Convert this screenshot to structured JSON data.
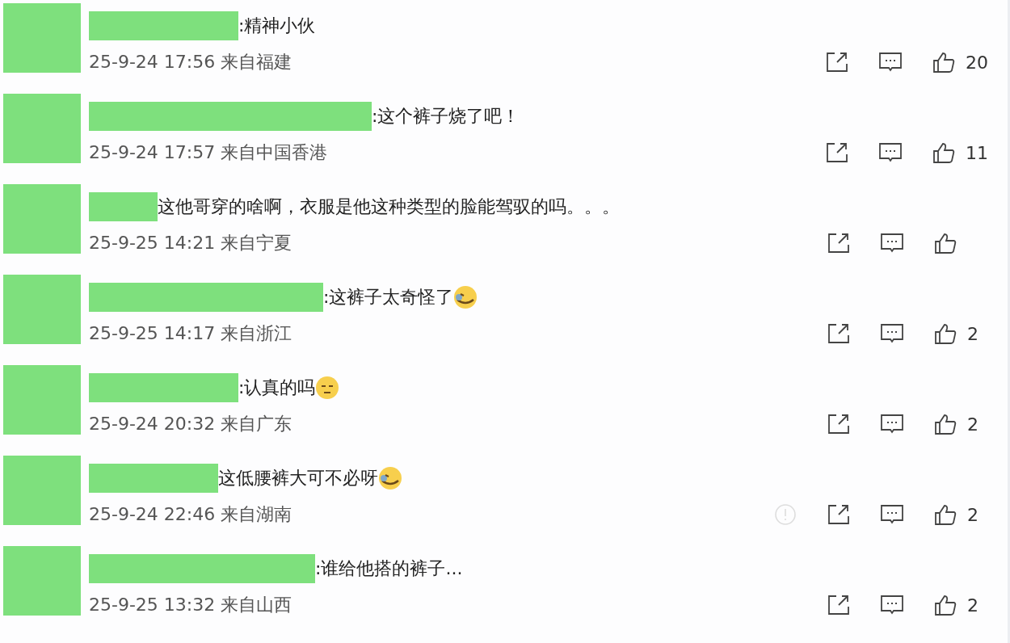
{
  "comments": [
    {
      "text": ":精神小伙",
      "kind": "plain",
      "meta": "25-9-24 17:56 来自福建",
      "report": false,
      "likes": "20"
    },
    {
      "text": ":这个裤子烧了吧！",
      "kind": "plain",
      "meta": "25-9-24 17:57 来自中国香港",
      "report": false,
      "likes": "11"
    },
    {
      "text": "这他哥穿的啥啊，衣服是他这种类型的脸能驾驭的吗。。。",
      "kind": "plain",
      "meta": "25-9-25 14:21 来自宁夏",
      "report": false
    },
    {
      "text": ":这裤子太奇怪了",
      "kind": "tears",
      "meta": "25-9-25 14:17 来自浙江",
      "report": false,
      "likes": "2"
    },
    {
      "text": ":认真的吗",
      "kind": "smirk",
      "meta": "25-9-24 20:32 来自广东",
      "report": false,
      "likes": "2"
    },
    {
      "text": "这低腰裤大可不必呀",
      "kind": "tears",
      "meta": "25-9-24 22:46 来自湖南",
      "report": true,
      "likes": "2"
    },
    {
      "text": ":谁给他搭的裤子...",
      "kind": "plain",
      "meta": "25-9-25 13:32 来自山西",
      "report": false,
      "likes": "2"
    }
  ]
}
